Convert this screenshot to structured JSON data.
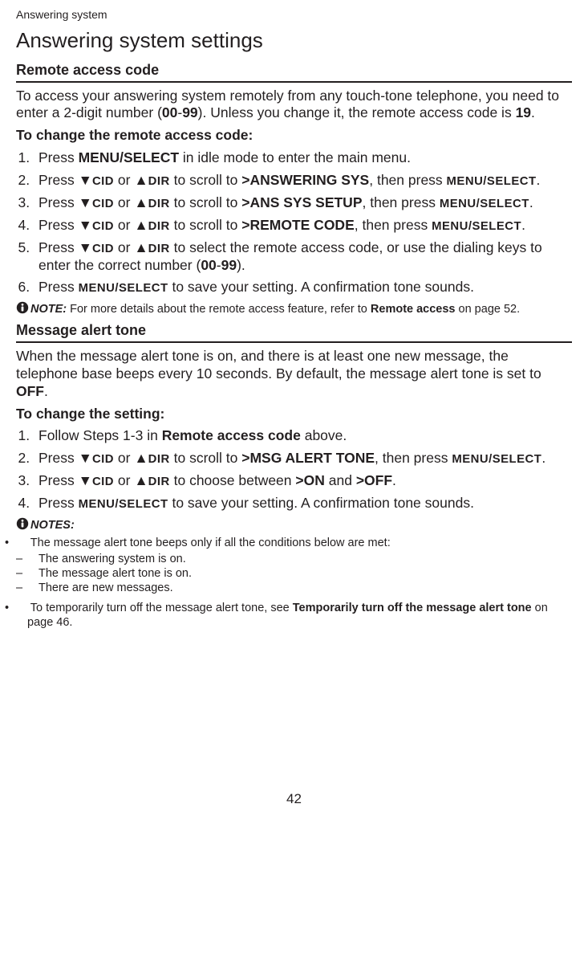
{
  "header": {
    "section": "Answering system"
  },
  "title": "Answering system settings",
  "remote": {
    "heading": "Remote access code",
    "intro_a": "To access your answering system remotely from any touch-tone telephone, you need to enter a 2-digit number (",
    "intro_b": "00",
    "intro_c": "-",
    "intro_d": "99",
    "intro_e": "). Unless you change it, the remote access code is ",
    "intro_f": "19",
    "intro_g": ".",
    "change_heading": "To change the remote access code:",
    "step1_a": "Press ",
    "step1_b": "MENU/SELECT",
    "step1_c": " in idle mode to enter the main menu.",
    "step2_a": "Press ",
    "step2_down": "▼",
    "step2_cid": "CID",
    "step2_or": " or ",
    "step2_up": "▲",
    "step2_dir": "DIR",
    "step2_b": " to scroll to ",
    "step2_c": ">ANSWERING SYS",
    "step2_d": ", then press ",
    "step2_e": "MENU/SELECT",
    "step2_f": ".",
    "step3_c": ">ANS SYS SETUP",
    "step4_c": ">REMOTE CODE",
    "step4_d": ", then press ",
    "step4_e": "MENU/SELECT",
    "step4_f": ".",
    "step5_a": "Press ",
    "step5_b": " to select the remote access code, or use the dialing keys to enter the correct number (",
    "step5_c": "00",
    "step5_d": "-",
    "step5_e": "99",
    "step5_f": ").",
    "step6_a": "Press ",
    "step6_b": "MENU/SELECT",
    "step6_c": " to save your setting. A confirmation tone sounds.",
    "note_label": "NOTE:",
    "note_a": " For more details about the remote access feature, refer to ",
    "note_b": "Remote access",
    "note_c": " on page 52."
  },
  "alert": {
    "heading": "Message alert tone",
    "intro_a": "When the message alert tone is on, and there is at least one new message, the telephone base beeps every 10 seconds. By default, the message alert tone is set to ",
    "intro_b": "OFF",
    "intro_c": ".",
    "change_heading": "To change the setting:",
    "step1_a": "Follow Steps 1-3 in ",
    "step1_b": "Remote access code",
    "step1_c": " above.",
    "step2_c": ">MSG ALERT TONE",
    "step3_b": " to choose between ",
    "step3_c": ">ON",
    "step3_d": " and ",
    "step3_e": ">OFF",
    "step3_f": ".",
    "notes_label": "NOTES:",
    "bullet1": "The message alert tone beeps only if all the conditions below are met:",
    "sub1": "The answering system is on.",
    "sub2": "The message alert tone is on.",
    "sub3": "There are new messages.",
    "bullet2_a": "To temporarily turn off the message alert tone, see ",
    "bullet2_b": "Temporarily turn off the message alert tone",
    "bullet2_c": " on page 46."
  },
  "pagenum": "42"
}
